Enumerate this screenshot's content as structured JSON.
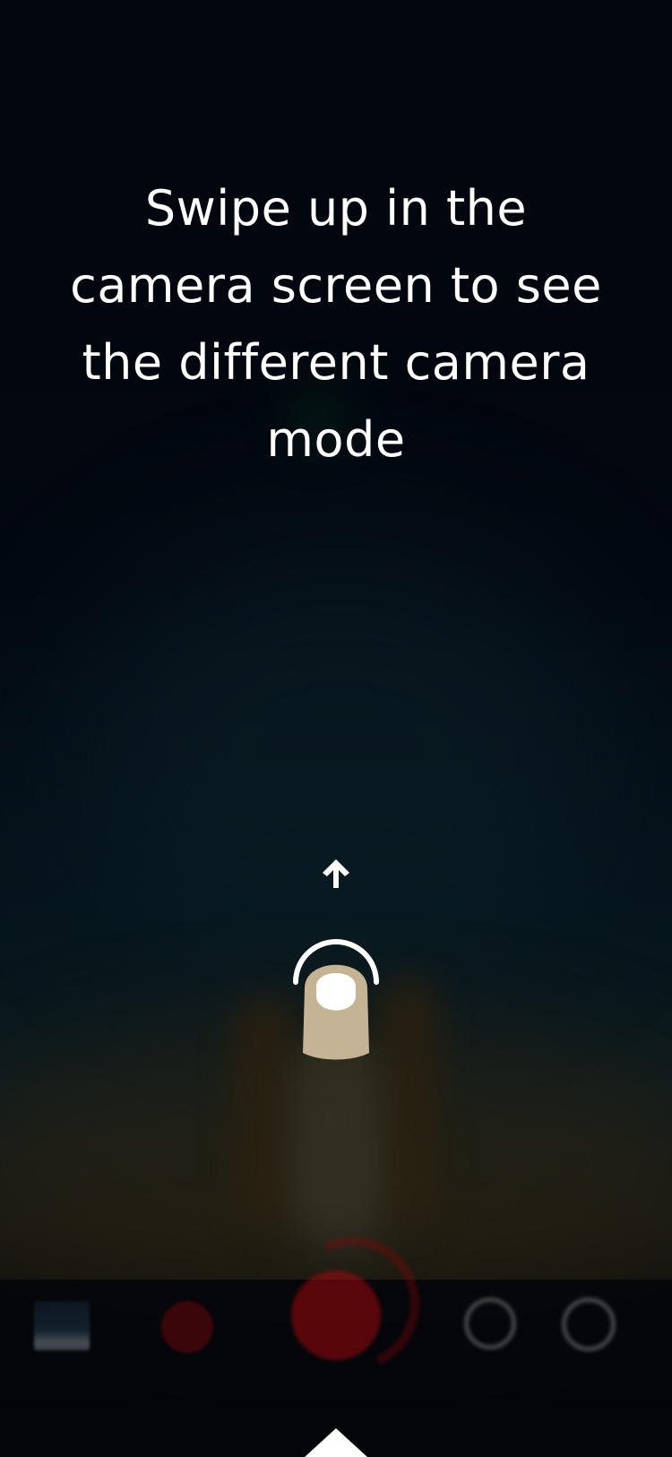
{
  "overlay": {
    "hint_text": "Swipe up in the camera screen to see the different camera mode",
    "arrow_icon": "arrow-up-icon",
    "gesture_icon": "finger-swipe-icon",
    "finger_color": "#c4b394",
    "arrow_color": "#ffffff"
  },
  "camera_controls": {
    "gallery_icon": "gallery-thumbnail",
    "live_icon": "live-mode-icon",
    "shutter_icon": "shutter-button",
    "flip_icon": "flip-camera-icon",
    "effects_icon": "face-effects-icon",
    "accent_color": "#c0070d"
  },
  "bottom_handle": {
    "icon": "caret-up-icon"
  }
}
